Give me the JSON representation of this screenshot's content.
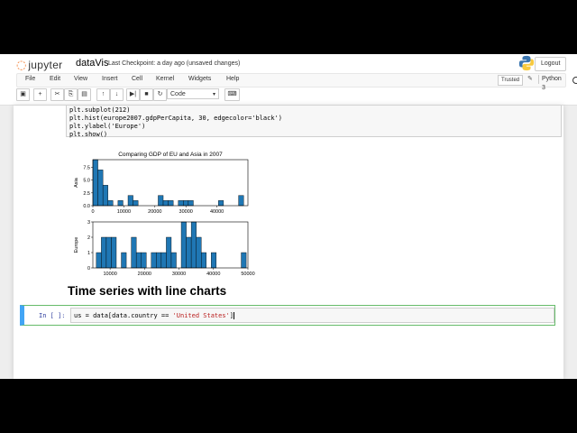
{
  "app": {
    "logo_text": "jupyter",
    "notebook_name": "dataVis",
    "checkpoint": "Last Checkpoint: a day ago (unsaved changes)",
    "logout_label": "Logout"
  },
  "menu": {
    "items": [
      "File",
      "Edit",
      "View",
      "Insert",
      "Cell",
      "Kernel",
      "Widgets",
      "Help"
    ],
    "trusted_label": "Trusted",
    "kernel_label": "Python 3"
  },
  "toolbar": {
    "buttons": [
      "save-icon",
      "plus-icon",
      "cut-icon",
      "copy-icon",
      "paste-icon",
      "arrow-up-icon",
      "arrow-down-icon",
      "step-forward-icon",
      "stop-icon",
      "restart-icon"
    ],
    "celltype_value": "Code",
    "keyboard_icon": "keyboard-icon"
  },
  "code_cell": {
    "lines": [
      "plt.subplot(212)",
      "plt.hist(europe2007.gdpPerCapita, 30, edgecolor='black')",
      "plt.ylabel('Europe')",
      "plt.show()"
    ]
  },
  "chart_data": [
    {
      "type": "bar",
      "title": "Comparing GDP of EU and Asia in 2007",
      "ylabel": "Asia",
      "xlim": [
        0,
        50000
      ],
      "ylim": [
        0,
        9
      ],
      "xticks": [
        "0",
        "10000",
        "20000",
        "30000",
        "40000"
      ],
      "yticks": [
        "0.0",
        "2.5",
        "5.0",
        "7.5"
      ],
      "bin_width": 1620,
      "bin_starts": [
        0,
        1620,
        3240,
        4860,
        6480,
        8100,
        9720,
        11340,
        12960,
        14580,
        16200,
        17820,
        19440,
        21060,
        22680,
        24300,
        25920,
        27540,
        29160,
        30780,
        32400,
        34020,
        35640,
        37260,
        38880,
        40500,
        42120,
        43740,
        45360,
        46980
      ],
      "values": [
        9,
        7,
        4,
        1,
        0,
        1,
        0,
        2,
        1,
        0,
        0,
        0,
        0,
        2,
        1,
        1,
        0,
        1,
        1,
        1,
        0,
        0,
        0,
        0,
        0,
        1,
        0,
        0,
        0,
        2
      ],
      "color": "#1f77b4"
    },
    {
      "type": "bar",
      "ylabel": "Europe",
      "xlim": [
        5000,
        50000
      ],
      "ylim": [
        0,
        3
      ],
      "xticks": [
        "10000",
        "20000",
        "30000",
        "40000",
        "50000"
      ],
      "yticks": [
        "0",
        "1",
        "2",
        "3"
      ],
      "bin_width": 1450,
      "bin_starts": [
        6000,
        7450,
        8900,
        10350,
        11800,
        13250,
        14700,
        16150,
        17600,
        19050,
        20500,
        21950,
        23400,
        24850,
        26300,
        27750,
        29200,
        30650,
        32100,
        33550,
        35000,
        36450,
        37900,
        39350,
        40800,
        42250,
        43700,
        45150,
        46600,
        48050
      ],
      "values": [
        1,
        2,
        2,
        2,
        0,
        1,
        0,
        2,
        1,
        1,
        0,
        1,
        1,
        1,
        2,
        1,
        0,
        3,
        2,
        3,
        2,
        1,
        0,
        1,
        0,
        0,
        0,
        0,
        0,
        1
      ],
      "color": "#1f77b4"
    }
  ],
  "section_heading": "Time series with line charts",
  "input_cell": {
    "prompt": "In [ ]:",
    "code_prefix": "us = data[data.country == ",
    "code_string": "'United States'",
    "code_suffix": "]"
  }
}
